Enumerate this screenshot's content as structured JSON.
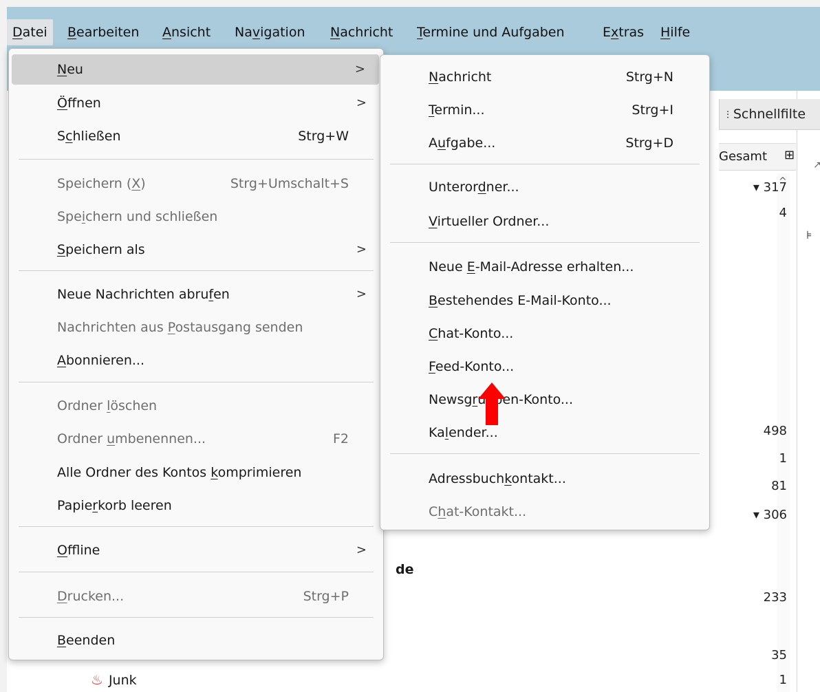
{
  "menubar": {
    "items": [
      {
        "pre": "",
        "u": "D",
        "post": "atei",
        "active": true
      },
      {
        "pre": "",
        "u": "B",
        "post": "earbeiten"
      },
      {
        "pre": "",
        "u": "A",
        "post": "nsicht"
      },
      {
        "pre": "Na",
        "u": "v",
        "post": "igation"
      },
      {
        "pre": "",
        "u": "N",
        "post": "achricht"
      },
      {
        "pre": "",
        "u": "T",
        "post": "ermine und Aufgaben"
      },
      {
        "pre": "E",
        "u": "x",
        "post": "tras"
      },
      {
        "pre": "",
        "u": "H",
        "post": "ilfe"
      }
    ]
  },
  "file_menu": {
    "new": {
      "pre": "",
      "u": "N",
      "post": "eu"
    },
    "open": {
      "pre": "",
      "u": "Ö",
      "post": "ffnen"
    },
    "close": {
      "pre": "S",
      "u": "c",
      "post": "hließen",
      "acc": "Strg+W"
    },
    "save": {
      "pre": "Speichern (",
      "u": "X",
      "post": ")",
      "acc": "Strg+Umschalt+S"
    },
    "save_close": {
      "pre": "Spe",
      "u": "i",
      "post": "chern und schließen"
    },
    "save_as": {
      "pre": "",
      "u": "S",
      "post": "peichern als"
    },
    "get_messages": {
      "pre": "Neue Nachrichten abru",
      "u": "f",
      "post": "en"
    },
    "send_outbox": {
      "pre": "Nachrichten aus ",
      "u": "P",
      "post": "ostausgang senden"
    },
    "subscribe": {
      "pre": "",
      "u": "A",
      "post": "bonnieren..."
    },
    "delete_folder": {
      "pre": "Ordner ",
      "u": "l",
      "post": "öschen"
    },
    "rename_folder": {
      "pre": "Ordner ",
      "u": "u",
      "post": "mbenennen...",
      "acc": "F2"
    },
    "compact": {
      "pre": "Alle Ordner des Kontos ",
      "u": "k",
      "post": "omprimieren"
    },
    "empty_trash": {
      "pre": "Papie",
      "u": "r",
      "post": "korb leeren"
    },
    "offline": {
      "pre": "",
      "u": "O",
      "post": "ffline"
    },
    "print": {
      "pre": "",
      "u": "D",
      "post": "rucken...",
      "acc": "Strg+P"
    },
    "quit": {
      "pre": "",
      "u": "B",
      "post": "eenden"
    }
  },
  "new_submenu": {
    "message": {
      "pre": "",
      "u": "N",
      "post": "achricht",
      "acc": "Strg+N"
    },
    "event": {
      "pre": "",
      "u": "T",
      "post": "ermin...",
      "acc": "Strg+I"
    },
    "task": {
      "pre": "A",
      "u": "u",
      "post": "fgabe...",
      "acc": "Strg+D"
    },
    "subfolder": {
      "pre": "Unteror",
      "u": "d",
      "post": "ner..."
    },
    "virtual_folder": {
      "pre": "",
      "u": "V",
      "post": "irtueller Ordner..."
    },
    "new_email_address": {
      "pre": "Neue ",
      "u": "E",
      "post": "-Mail-Adresse erhalten..."
    },
    "existing_email": {
      "pre": "",
      "u": "B",
      "post": "estehendes E-Mail-Konto..."
    },
    "chat_account": {
      "pre": "",
      "u": "C",
      "post": "hat-Konto..."
    },
    "feed_account": {
      "pre": "",
      "u": "F",
      "post": "eed-Konto..."
    },
    "newsgroup_account": {
      "pre": "Newsg",
      "u": "r",
      "post": "uppen-Konto..."
    },
    "calendar": {
      "pre": "Ka",
      "u": "l",
      "post": "ender..."
    },
    "address_contact": {
      "pre": "Adressbuch",
      "u": "k",
      "post": "ontakt..."
    },
    "chat_contact": {
      "pre": "C",
      "u": "h",
      "post": "at-Kontakt..."
    }
  },
  "background": {
    "quickfilter": "Schnellfilte",
    "col_total": "Gesamt",
    "counts": [
      "▾ 317",
      "4",
      "498",
      "1",
      "81",
      "▾ 306",
      "233",
      "35",
      "1"
    ],
    "folder_partial": "de",
    "junk_label": "Junk"
  },
  "icons": {
    "quickfilter": "filter-sliders-icon",
    "column_picker": "column-picker-icon",
    "submenu_arrow": "chevron-right-icon",
    "junk": "junk-flame-icon",
    "annotation": "red-up-arrow"
  },
  "colors": {
    "menubar": "#a9cbdc",
    "highlight": "#d1d1d1",
    "annotation": "#ff0000",
    "junk": "#d0343a"
  }
}
